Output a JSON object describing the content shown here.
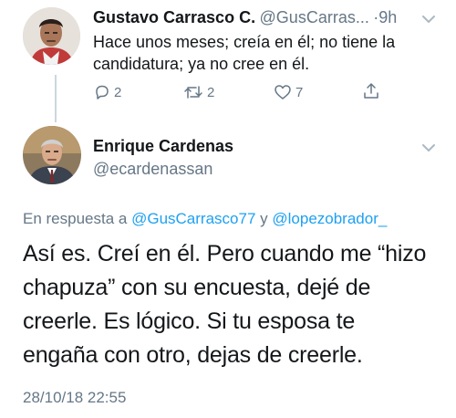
{
  "tweet1": {
    "name": "Gustavo Carrasco C.",
    "handle": "@GusCarras...",
    "separator": "·",
    "time": "9h",
    "text_line1": "Hace unos meses; creía en él; no tiene la",
    "text_line2": "candidatura; ya no cree en él.",
    "actions": {
      "reply_count": "2",
      "retweet_count": "2",
      "like_count": "7"
    }
  },
  "tweet2": {
    "name": "Enrique Cardenas",
    "handle": "@ecardenassan",
    "reply_prefix": "En respuesta a",
    "reply_user1": "@GusCarrasco77",
    "reply_joiner": "y",
    "reply_user2": "@lopezobrador_",
    "text_line1": "Así es. Creí en él. Pero cuando me “hizo",
    "text_line2": "chapuza” con su encuesta, dejé de",
    "text_line3": "creerle. Es lógico. Si tu esposa te",
    "text_line4": "engaña con otro, dejas de creerle.",
    "date": "28/10/18 22:55"
  },
  "colors": {
    "link": "#1da1f2",
    "muted": "#657786",
    "text": "#14171a",
    "thread_line": "#ccd6dd"
  }
}
